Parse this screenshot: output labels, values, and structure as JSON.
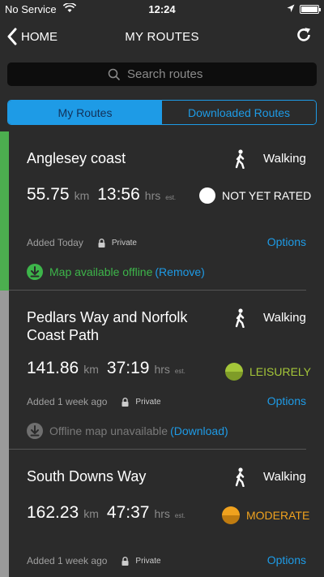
{
  "status_bar": {
    "carrier": "No Service",
    "time": "12:24"
  },
  "nav": {
    "back_label": "HOME",
    "title": "MY ROUTES"
  },
  "search": {
    "placeholder": "Search routes"
  },
  "tabs": [
    {
      "label": "My Routes",
      "active": true
    },
    {
      "label": "Downloaded Routes",
      "active": false
    }
  ],
  "colors": {
    "accent": "#1e9be6",
    "offline_green": "#3db54a",
    "leisurely": "#a4c639",
    "moderate": "#f0a21e",
    "bar_green": "#4cae4f",
    "bar_grey": "#9a9a9a"
  },
  "routes": [
    {
      "name": "Anglesey coast",
      "activity": "Walking",
      "activity_icon": "walking-icon",
      "distance": "55.75",
      "distance_unit": "km",
      "duration": "13:56",
      "duration_unit": "hrs",
      "est": "est.",
      "rating": "NOT YET RATED",
      "added": "Added Today",
      "privacy": "Private",
      "options": "Options",
      "offline_text": "Map available offline",
      "offline_link": "(Remove)"
    },
    {
      "name": "Pedlars Way and Norfolk Coast Path",
      "activity": "Walking",
      "activity_icon": "walking-icon",
      "distance": "141.86",
      "distance_unit": "km",
      "duration": "37:19",
      "duration_unit": "hrs",
      "est": "est.",
      "rating": "LEISURELY",
      "added": "Added 1 week ago",
      "privacy": "Private",
      "options": "Options",
      "offline_text": "Offline map unavailable",
      "offline_link": "(Download)"
    },
    {
      "name": "South Downs Way",
      "activity": "Walking",
      "activity_icon": "walking-icon",
      "distance": "162.23",
      "distance_unit": "km",
      "duration": "47:37",
      "duration_unit": "hrs",
      "est": "est.",
      "rating": "MODERATE",
      "added": "Added 1 week ago",
      "privacy": "Private",
      "options": "Options"
    }
  ]
}
